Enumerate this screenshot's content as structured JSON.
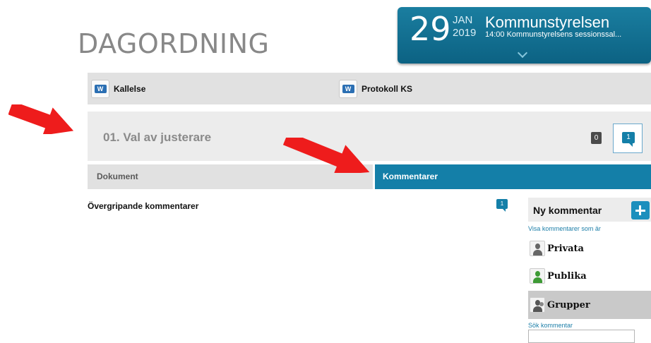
{
  "page": {
    "title": "DAGORDNING"
  },
  "meeting": {
    "day": "29",
    "month": "JAN",
    "year": "2019",
    "name": "Kommunstyrelsen",
    "detail": "14:00 Kommunstyrelsens sessionssal..."
  },
  "documents": [
    {
      "label": "Kallelse",
      "icon": "word-document-icon"
    },
    {
      "label": "Protokoll KS",
      "icon": "word-document-icon"
    }
  ],
  "agenda_item": {
    "title": "01. Val av justerare",
    "document_count": "0",
    "comment_count": "1"
  },
  "tabs": {
    "documents": "Dokument",
    "comments": "Kommentarer",
    "active": "Kommentarer"
  },
  "comments": {
    "overall_label": "Övergripande kommentarer",
    "overall_count": "1",
    "new_comment": "Ny kommentar",
    "show_as_label": "Visa kommentarer som är",
    "filters": [
      {
        "label": "Privata",
        "icon": "user-gray-icon"
      },
      {
        "label": "Publika",
        "icon": "user-green-icon"
      },
      {
        "label": "Grupper",
        "icon": "group-icon",
        "selected": true
      }
    ],
    "search_label": "Sök kommentar",
    "search_value": ""
  },
  "annotations": {
    "arrow_color": "#ee1c1c"
  },
  "colors": {
    "accent": "#147fa8",
    "banner": "#0c6283"
  }
}
